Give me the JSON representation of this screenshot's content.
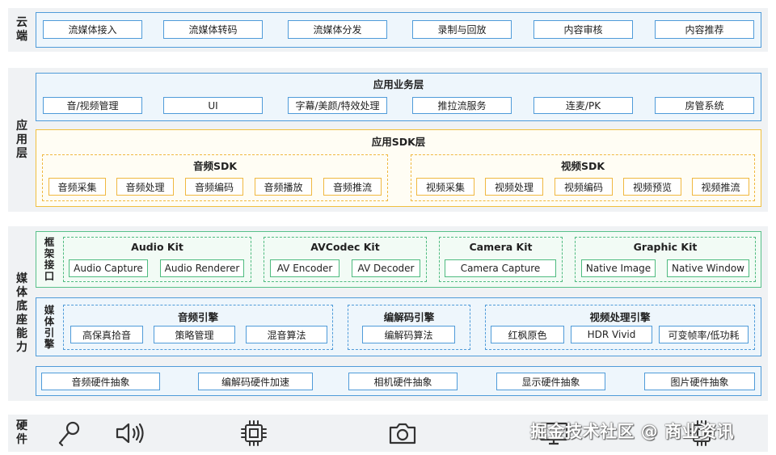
{
  "cloud": {
    "label": "云\n端",
    "items": [
      "流媒体接入",
      "流媒体转码",
      "流媒体分发",
      "录制与回放",
      "内容审核",
      "内容推荐"
    ]
  },
  "app": {
    "label": "应\n用\n层",
    "business": {
      "title": "应用业务层",
      "items": [
        "音/视频管理",
        "UI",
        "字幕/美颜/特效处理",
        "推拉流服务",
        "连麦/PK",
        "房管系统"
      ]
    },
    "sdk": {
      "title": "应用SDK层",
      "audio": {
        "title": "音频SDK",
        "items": [
          "音频采集",
          "音频处理",
          "音频编码",
          "音频播放",
          "音频推流"
        ]
      },
      "video": {
        "title": "视频SDK",
        "items": [
          "视频采集",
          "视频处理",
          "视频编码",
          "视频预览",
          "视频推流"
        ]
      }
    }
  },
  "media": {
    "label": "媒\n体\n底\n座\n能\n力",
    "framework": {
      "label": "框\n架\n接\n口",
      "kits": [
        {
          "title": "Audio Kit",
          "items": [
            "Audio Capture",
            "Audio Renderer"
          ]
        },
        {
          "title": "AVCodec Kit",
          "items": [
            "AV Encoder",
            "AV Decoder"
          ]
        },
        {
          "title": "Camera Kit",
          "items": [
            "Camera Capture"
          ]
        },
        {
          "title": "Graphic Kit",
          "items": [
            "Native Image",
            "Native Window"
          ]
        }
      ]
    },
    "engine": {
      "label": "媒\n体\n引\n擎",
      "groups": [
        {
          "title": "音频引擎",
          "items": [
            "高保真拾音",
            "策略管理",
            "混音算法"
          ]
        },
        {
          "title": "编解码引擎",
          "items": [
            "编解码算法"
          ]
        },
        {
          "title": "视频处理引擎",
          "items": [
            "红枫原色",
            "HDR Vivid",
            "可变帧率/低功耗"
          ]
        }
      ]
    },
    "hw_abstraction": [
      "音频硬件抽象",
      "编解码硬件加速",
      "相机硬件抽象",
      "显示硬件抽象",
      "图片硬件抽象"
    ]
  },
  "hardware": {
    "label": "硬\n件",
    "icons": [
      "microphone-icon",
      "speaker-icon",
      "chip-icon",
      "camera-icon",
      "display-icon",
      "chip-icon"
    ]
  },
  "watermark": "掘金技术社区 @ 商业资讯",
  "colors": {
    "blue": "#4f9bd9",
    "yellow": "#f0c040",
    "green": "#58c08a",
    "band": "#f0f2f4"
  }
}
